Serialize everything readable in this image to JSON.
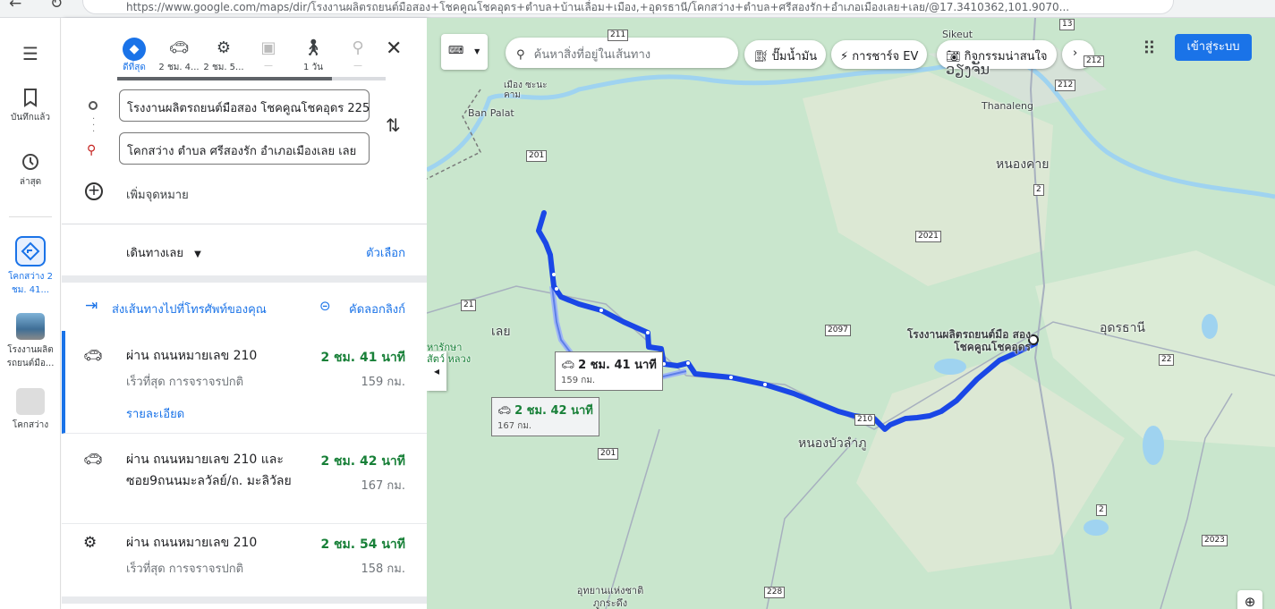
{
  "browser": {
    "back": "←",
    "reload": "↻",
    "url": "https://www.google.com/maps/dir/โรงงานผลิตรถยนต์มือสอง+โชคคูณโชคอุดร+ตำบล+บ้านเลื่อม+เมือง,+อุดรธานี/โคกสว่าง+ตำบล+ศรีสองรัก+อำเภอเมืองเลย+เลย/@17.3410362,101.9070..."
  },
  "rail": {
    "menu_icon": "menu-icon",
    "items": [
      {
        "label": "บันทึกแล้ว",
        "icon": "bookmark-icon"
      },
      {
        "label": "ล่าสุด",
        "icon": "history-icon"
      },
      {
        "label": "โคกสว่าง 2 ชม. 41...",
        "icon": "directions-icon"
      },
      {
        "label": "โรงงานผลิต รถยนต์มือ...",
        "icon": "place-thumbnail"
      },
      {
        "label": "โคกสว่าง",
        "icon": "place-thumbnail"
      }
    ]
  },
  "modes": [
    {
      "label": "ดีที่สุด",
      "icon": "directions-icon",
      "active": true
    },
    {
      "label": "2 ชม. 4...",
      "icon": "car-icon"
    },
    {
      "label": "2 ชม. 5...",
      "icon": "motorcycle-icon"
    },
    {
      "label": "—",
      "icon": "transit-icon"
    },
    {
      "label": "1 วัน",
      "icon": "walk-icon"
    },
    {
      "label": "—",
      "icon": "bike-icon"
    }
  ],
  "inputs": {
    "origin": "โรงงานผลิตรถยนต์มือสอง โชคคูณโชคอุดร 225",
    "destination": "โคกสว่าง ตำบล ศรีสองรัก อำเภอเมืองเลย เลย",
    "add_destination": "เพิ่มจุดหมาย"
  },
  "options": {
    "depart": "เดินทางเลย",
    "options_link": "ตัวเลือก",
    "send_to_phone": "ส่งเส้นทางไปที่โทรศัพท์ของคุณ",
    "copy_link": "คัดลอกลิงก์"
  },
  "routes": [
    {
      "title": "ผ่าน ถนนหมายเลข 210",
      "time": "2 ชม. 41 นาที",
      "sub": "เร็วที่สุด การจราจรปกติ",
      "dist": "159 กม.",
      "details": "รายละเอียด",
      "icon": "car-icon",
      "selected": true
    },
    {
      "title": "ผ่าน ถนนหมายเลข 210 และ ซอย9ถนนมะลวัลย์/ถ. มะลิวัลย",
      "time": "2 ชม. 42 นาที",
      "dist": "167 กม.",
      "icon": "car-icon"
    },
    {
      "title": "ผ่าน ถนนหมายเลข 210",
      "time": "2 ชม. 54 นาที",
      "sub": "เร็วที่สุด การจราจรปกติ",
      "dist": "158 กม.",
      "icon": "motorcycle-icon"
    }
  ],
  "map": {
    "search_placeholder": "ค้นหาสิ่งที่อยู่ในเส้นทาง",
    "chips": [
      "ปั๊มน้ำมัน",
      "การชาร์จ EV",
      "กิจกรรมน่าสนใจ"
    ],
    "signin": "เข้าสู่ระบบ",
    "callout_main": {
      "time": "2 ชม. 41 นาที",
      "dist": "159 กม."
    },
    "callout_alt": {
      "time": "2 ชม. 42 นาที",
      "dist": "167 กม."
    },
    "origin_label": "โรงงานผลิตรถยนต์มือ สอง โชคคูณโชคอุดร",
    "places": [
      "เลย",
      "หนองบัวลำภู",
      "อุดรธานี",
      "หนองคาย",
      "Thanaleng",
      "Sikeut",
      "ວຽງຈັນ",
      "Ban Palat",
      "เมือง ซะนะคาม",
      "อุทยานแห่งชาติ ภูกระดึง",
      "หารักษา สัตว์ หลวง"
    ],
    "shields": [
      "211",
      "201",
      "21",
      "2097",
      "2021",
      "22",
      "2",
      "210",
      "201",
      "228",
      "2023",
      "212",
      "212",
      "13",
      "2"
    ],
    "colors": {
      "route": "#1a47e6",
      "alt_route": "#9fb6f5",
      "water": "#9fd3f0",
      "land": "#c9e6cd"
    }
  }
}
